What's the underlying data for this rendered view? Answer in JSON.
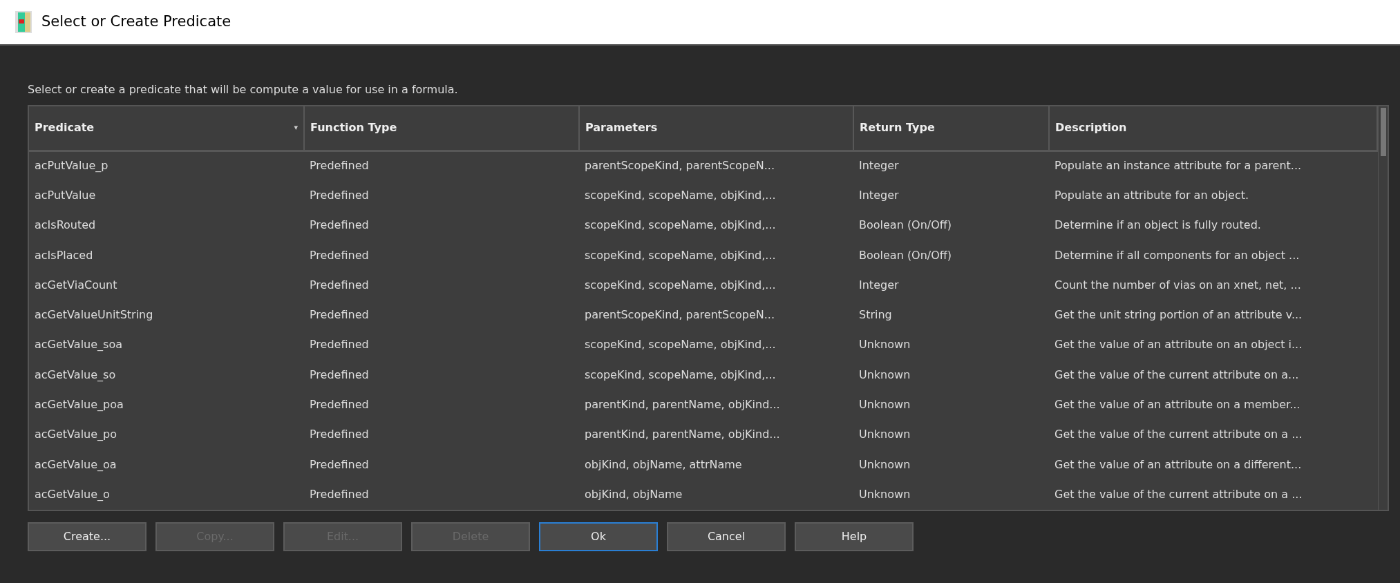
{
  "window": {
    "title": "Select or Create Predicate"
  },
  "instruction": "Select or create a predicate that will be compute a value for use in a formula.",
  "table": {
    "columns": [
      {
        "label": "Predicate",
        "sort": "▾"
      },
      {
        "label": "Function Type"
      },
      {
        "label": "Parameters"
      },
      {
        "label": "Return Type"
      },
      {
        "label": "Description"
      }
    ],
    "rows": [
      [
        "acPutValue_p",
        "Predefined",
        "parentScopeKind, parentScopeN...",
        "Integer",
        "Populate an instance attribute for a parent..."
      ],
      [
        "acPutValue",
        "Predefined",
        "scopeKind, scopeName, objKind,...",
        "Integer",
        "Populate an attribute for an object."
      ],
      [
        "acIsRouted",
        "Predefined",
        "scopeKind, scopeName, objKind,...",
        "Boolean (On/Off)",
        "Determine if an object is fully routed."
      ],
      [
        "acIsPlaced",
        "Predefined",
        "scopeKind, scopeName, objKind,...",
        "Boolean (On/Off)",
        "Determine if all components for an object ..."
      ],
      [
        "acGetViaCount",
        "Predefined",
        "scopeKind, scopeName, objKind,...",
        "Integer",
        "Count the number of vias on an xnet, net, ..."
      ],
      [
        "acGetValueUnitString",
        "Predefined",
        "parentScopeKind, parentScopeN...",
        "String",
        "Get the unit string portion of an attribute v..."
      ],
      [
        "acGetValue_soa",
        "Predefined",
        "scopeKind, scopeName, objKind,...",
        "Unknown",
        "Get the value of an attribute on an object i..."
      ],
      [
        "acGetValue_so",
        "Predefined",
        "scopeKind, scopeName, objKind,...",
        "Unknown",
        "Get the value of the current attribute on a..."
      ],
      [
        "acGetValue_poa",
        "Predefined",
        "parentKind, parentName, objKind...",
        "Unknown",
        "Get the value of an attribute on a member..."
      ],
      [
        "acGetValue_po",
        "Predefined",
        "parentKind, parentName, objKind...",
        "Unknown",
        "Get the value of the current attribute on a ..."
      ],
      [
        "acGetValue_oa",
        "Predefined",
        "objKind, objName, attrName",
        "Unknown",
        "Get the value of an attribute on a different..."
      ],
      [
        "acGetValue_o",
        "Predefined",
        "objKind, objName",
        "Unknown",
        "Get the value of the current attribute on a ..."
      ]
    ]
  },
  "buttons": [
    {
      "label": "Create...",
      "disabled": false,
      "focused": false
    },
    {
      "label": "Copy...",
      "disabled": true,
      "focused": false
    },
    {
      "label": "Edit...",
      "disabled": true,
      "focused": false
    },
    {
      "label": "Delete",
      "disabled": true,
      "focused": false
    },
    {
      "label": "Ok",
      "disabled": false,
      "focused": true
    },
    {
      "label": "Cancel",
      "disabled": false,
      "focused": false
    },
    {
      "label": "Help",
      "disabled": false,
      "focused": false
    }
  ]
}
